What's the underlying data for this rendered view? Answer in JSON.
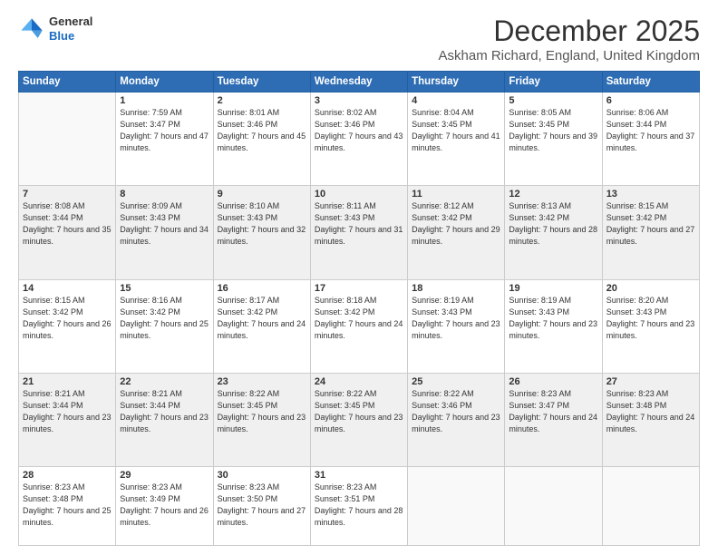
{
  "logo": {
    "line1": "General",
    "line2": "Blue"
  },
  "header": {
    "month": "December 2025",
    "location": "Askham Richard, England, United Kingdom"
  },
  "days_of_week": [
    "Sunday",
    "Monday",
    "Tuesday",
    "Wednesday",
    "Thursday",
    "Friday",
    "Saturday"
  ],
  "weeks": [
    [
      {
        "day": "",
        "sunrise": "",
        "sunset": "",
        "daylight": "",
        "empty": true
      },
      {
        "day": "1",
        "sunrise": "Sunrise: 7:59 AM",
        "sunset": "Sunset: 3:47 PM",
        "daylight": "Daylight: 7 hours and 47 minutes."
      },
      {
        "day": "2",
        "sunrise": "Sunrise: 8:01 AM",
        "sunset": "Sunset: 3:46 PM",
        "daylight": "Daylight: 7 hours and 45 minutes."
      },
      {
        "day": "3",
        "sunrise": "Sunrise: 8:02 AM",
        "sunset": "Sunset: 3:46 PM",
        "daylight": "Daylight: 7 hours and 43 minutes."
      },
      {
        "day": "4",
        "sunrise": "Sunrise: 8:04 AM",
        "sunset": "Sunset: 3:45 PM",
        "daylight": "Daylight: 7 hours and 41 minutes."
      },
      {
        "day": "5",
        "sunrise": "Sunrise: 8:05 AM",
        "sunset": "Sunset: 3:45 PM",
        "daylight": "Daylight: 7 hours and 39 minutes."
      },
      {
        "day": "6",
        "sunrise": "Sunrise: 8:06 AM",
        "sunset": "Sunset: 3:44 PM",
        "daylight": "Daylight: 7 hours and 37 minutes."
      }
    ],
    [
      {
        "day": "7",
        "sunrise": "Sunrise: 8:08 AM",
        "sunset": "Sunset: 3:44 PM",
        "daylight": "Daylight: 7 hours and 35 minutes."
      },
      {
        "day": "8",
        "sunrise": "Sunrise: 8:09 AM",
        "sunset": "Sunset: 3:43 PM",
        "daylight": "Daylight: 7 hours and 34 minutes."
      },
      {
        "day": "9",
        "sunrise": "Sunrise: 8:10 AM",
        "sunset": "Sunset: 3:43 PM",
        "daylight": "Daylight: 7 hours and 32 minutes."
      },
      {
        "day": "10",
        "sunrise": "Sunrise: 8:11 AM",
        "sunset": "Sunset: 3:43 PM",
        "daylight": "Daylight: 7 hours and 31 minutes."
      },
      {
        "day": "11",
        "sunrise": "Sunrise: 8:12 AM",
        "sunset": "Sunset: 3:42 PM",
        "daylight": "Daylight: 7 hours and 29 minutes."
      },
      {
        "day": "12",
        "sunrise": "Sunrise: 8:13 AM",
        "sunset": "Sunset: 3:42 PM",
        "daylight": "Daylight: 7 hours and 28 minutes."
      },
      {
        "day": "13",
        "sunrise": "Sunrise: 8:15 AM",
        "sunset": "Sunset: 3:42 PM",
        "daylight": "Daylight: 7 hours and 27 minutes."
      }
    ],
    [
      {
        "day": "14",
        "sunrise": "Sunrise: 8:15 AM",
        "sunset": "Sunset: 3:42 PM",
        "daylight": "Daylight: 7 hours and 26 minutes."
      },
      {
        "day": "15",
        "sunrise": "Sunrise: 8:16 AM",
        "sunset": "Sunset: 3:42 PM",
        "daylight": "Daylight: 7 hours and 25 minutes."
      },
      {
        "day": "16",
        "sunrise": "Sunrise: 8:17 AM",
        "sunset": "Sunset: 3:42 PM",
        "daylight": "Daylight: 7 hours and 24 minutes."
      },
      {
        "day": "17",
        "sunrise": "Sunrise: 8:18 AM",
        "sunset": "Sunset: 3:42 PM",
        "daylight": "Daylight: 7 hours and 24 minutes."
      },
      {
        "day": "18",
        "sunrise": "Sunrise: 8:19 AM",
        "sunset": "Sunset: 3:43 PM",
        "daylight": "Daylight: 7 hours and 23 minutes."
      },
      {
        "day": "19",
        "sunrise": "Sunrise: 8:19 AM",
        "sunset": "Sunset: 3:43 PM",
        "daylight": "Daylight: 7 hours and 23 minutes."
      },
      {
        "day": "20",
        "sunrise": "Sunrise: 8:20 AM",
        "sunset": "Sunset: 3:43 PM",
        "daylight": "Daylight: 7 hours and 23 minutes."
      }
    ],
    [
      {
        "day": "21",
        "sunrise": "Sunrise: 8:21 AM",
        "sunset": "Sunset: 3:44 PM",
        "daylight": "Daylight: 7 hours and 23 minutes."
      },
      {
        "day": "22",
        "sunrise": "Sunrise: 8:21 AM",
        "sunset": "Sunset: 3:44 PM",
        "daylight": "Daylight: 7 hours and 23 minutes."
      },
      {
        "day": "23",
        "sunrise": "Sunrise: 8:22 AM",
        "sunset": "Sunset: 3:45 PM",
        "daylight": "Daylight: 7 hours and 23 minutes."
      },
      {
        "day": "24",
        "sunrise": "Sunrise: 8:22 AM",
        "sunset": "Sunset: 3:45 PM",
        "daylight": "Daylight: 7 hours and 23 minutes."
      },
      {
        "day": "25",
        "sunrise": "Sunrise: 8:22 AM",
        "sunset": "Sunset: 3:46 PM",
        "daylight": "Daylight: 7 hours and 23 minutes."
      },
      {
        "day": "26",
        "sunrise": "Sunrise: 8:23 AM",
        "sunset": "Sunset: 3:47 PM",
        "daylight": "Daylight: 7 hours and 24 minutes."
      },
      {
        "day": "27",
        "sunrise": "Sunrise: 8:23 AM",
        "sunset": "Sunset: 3:48 PM",
        "daylight": "Daylight: 7 hours and 24 minutes."
      }
    ],
    [
      {
        "day": "28",
        "sunrise": "Sunrise: 8:23 AM",
        "sunset": "Sunset: 3:48 PM",
        "daylight": "Daylight: 7 hours and 25 minutes."
      },
      {
        "day": "29",
        "sunrise": "Sunrise: 8:23 AM",
        "sunset": "Sunset: 3:49 PM",
        "daylight": "Daylight: 7 hours and 26 minutes."
      },
      {
        "day": "30",
        "sunrise": "Sunrise: 8:23 AM",
        "sunset": "Sunset: 3:50 PM",
        "daylight": "Daylight: 7 hours and 27 minutes."
      },
      {
        "day": "31",
        "sunrise": "Sunrise: 8:23 AM",
        "sunset": "Sunset: 3:51 PM",
        "daylight": "Daylight: 7 hours and 28 minutes."
      },
      {
        "day": "",
        "empty": true
      },
      {
        "day": "",
        "empty": true
      },
      {
        "day": "",
        "empty": true
      }
    ]
  ]
}
